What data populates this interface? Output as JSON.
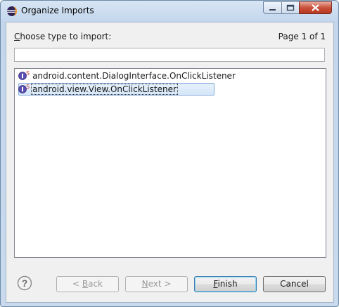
{
  "window": {
    "title": "Organize Imports"
  },
  "header": {
    "choose_prefix": "C",
    "choose_rest": "hoose type to import:",
    "page": "Page 1 of 1"
  },
  "filter": {
    "value": "",
    "placeholder": ""
  },
  "list": {
    "items": [
      {
        "label": "android.content.DialogInterface.OnClickListener",
        "selected": false
      },
      {
        "label": "android.view.View.OnClickListener",
        "selected": true
      }
    ]
  },
  "buttons": {
    "back_prefix": "< ",
    "back_u": "B",
    "back_rest": "ack",
    "next_u": "N",
    "next_rest": "ext >",
    "finish_u": "F",
    "finish_rest": "inish",
    "cancel": "Cancel"
  },
  "colors": {
    "interface_icon": "#5a4fb0",
    "selection": "#d4e6f8"
  }
}
